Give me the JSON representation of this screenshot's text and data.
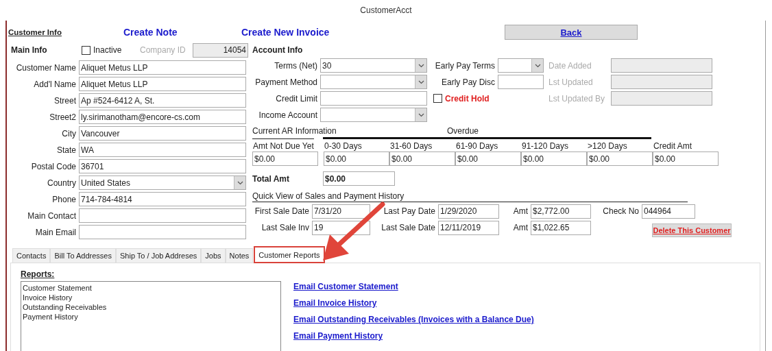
{
  "window": {
    "title": "CustomerAcct"
  },
  "header": {
    "section_title": "Customer Info",
    "links": [
      "Create Note",
      "Create New Invoice"
    ],
    "back_button": "Back"
  },
  "main_info": {
    "title": "Main Info",
    "inactive": {
      "label": "Inactive",
      "checked": false
    },
    "company_id": {
      "label": "Company ID",
      "value": "14054"
    },
    "fields": [
      {
        "label": "Customer Name",
        "value": "Aliquet Metus LLP",
        "kind": "text"
      },
      {
        "label": "Add'l Name",
        "value": "Aliquet Metus LLP",
        "kind": "text"
      },
      {
        "label": "Street",
        "value": "Ap #524-6412 A, St.",
        "kind": "text"
      },
      {
        "label": "Street2",
        "value": "ly.sirimanotham@encore-cs.com",
        "kind": "text"
      },
      {
        "label": "City",
        "value": "Vancouver",
        "kind": "text"
      },
      {
        "label": "State",
        "value": "WA",
        "kind": "text"
      },
      {
        "label": "Postal Code",
        "value": "36701",
        "kind": "text"
      },
      {
        "label": "Country",
        "value": "United States",
        "kind": "dropdown"
      },
      {
        "label": "Phone",
        "value": "714-784-4814",
        "kind": "text"
      },
      {
        "label": "Main Contact",
        "kind": "text"
      },
      {
        "label": "Main Email",
        "kind": "text"
      }
    ]
  },
  "account_info": {
    "title": "Account Info",
    "fields": [
      {
        "label": "Terms (Net)",
        "value": "30",
        "kind": "dropdown"
      },
      {
        "label": "Payment Method",
        "kind": "dropdown"
      },
      {
        "label": "Credit Limit",
        "kind": "text"
      },
      {
        "label": "Income Account",
        "kind": "dropdown"
      }
    ],
    "early_pay": [
      {
        "label": "Early Pay Terms",
        "kind": "dropdown"
      },
      {
        "label": "Early Pay Disc",
        "kind": "text"
      }
    ],
    "credit_hold": {
      "label": "Credit Hold",
      "checked": false
    },
    "audit_fields": [
      {
        "label": "Date Added"
      },
      {
        "label": "Lst Updated"
      },
      {
        "label": "Lst Updated By"
      }
    ]
  },
  "ar": {
    "title": "Current AR Information",
    "overdue_label": "Overdue",
    "columns": [
      {
        "label": "Amt Not Due Yet",
        "value": "$0.00"
      },
      {
        "label": "0-30 Days",
        "value": "$0.00"
      },
      {
        "label": "31-60 Days",
        "value": "$0.00"
      },
      {
        "label": "61-90 Days",
        "value": "$0.00"
      },
      {
        "label": "91-120 Days",
        "value": "$0.00"
      },
      {
        "label": ">120 Days",
        "value": "$0.00"
      },
      {
        "label": "Credit Amt",
        "value": "$0.00"
      }
    ],
    "total": {
      "label": "Total Amt",
      "value": "$0.00"
    }
  },
  "history": {
    "title": "Quick View of Sales and Payment History",
    "rows": [
      [
        {
          "label": "First Sale Date",
          "value": "7/31/20"
        },
        {
          "label": "Last Pay Date",
          "value": "1/29/2020"
        },
        {
          "label": "Amt",
          "value": "$2,772.00"
        },
        {
          "label": "Check No",
          "value": "044964"
        }
      ],
      [
        {
          "label": "Last Sale Inv",
          "value": "19"
        },
        {
          "label": "Last Sale Date",
          "value": "12/11/2019"
        },
        {
          "label": "Amt",
          "value": "$1,022.65"
        }
      ]
    ],
    "delete_button": "Delete This Customer"
  },
  "tabs": [
    {
      "label": "Contacts",
      "selected": false,
      "highlighted": false
    },
    {
      "label": "Bill To Addresses",
      "selected": false,
      "highlighted": false
    },
    {
      "label": "Ship To / Job Addreses",
      "selected": false,
      "highlighted": false
    },
    {
      "label": "Jobs",
      "selected": false,
      "highlighted": false
    },
    {
      "label": "Notes",
      "selected": false,
      "highlighted": false
    },
    {
      "label": "Customer Reports",
      "selected": true,
      "highlighted": true
    }
  ],
  "reports": {
    "title": "Reports:",
    "items": [
      "Customer Statement",
      "Invoice History",
      "Outstanding Receivables",
      "Payment History"
    ],
    "email_links": [
      "Email Customer Statement",
      "Email Invoice History",
      "Email Outstanding Receivables (Invoices with a Balance Due)",
      "Email Payment History"
    ]
  }
}
